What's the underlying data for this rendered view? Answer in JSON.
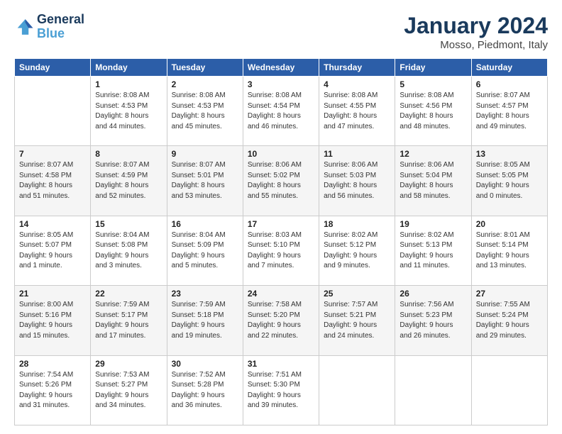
{
  "logo": {
    "line1": "General",
    "line2": "Blue"
  },
  "title": "January 2024",
  "subtitle": "Mosso, Piedmont, Italy",
  "days_of_week": [
    "Sunday",
    "Monday",
    "Tuesday",
    "Wednesday",
    "Thursday",
    "Friday",
    "Saturday"
  ],
  "weeks": [
    [
      {
        "day": "",
        "info": ""
      },
      {
        "day": "1",
        "info": "Sunrise: 8:08 AM\nSunset: 4:53 PM\nDaylight: 8 hours\nand 44 minutes."
      },
      {
        "day": "2",
        "info": "Sunrise: 8:08 AM\nSunset: 4:53 PM\nDaylight: 8 hours\nand 45 minutes."
      },
      {
        "day": "3",
        "info": "Sunrise: 8:08 AM\nSunset: 4:54 PM\nDaylight: 8 hours\nand 46 minutes."
      },
      {
        "day": "4",
        "info": "Sunrise: 8:08 AM\nSunset: 4:55 PM\nDaylight: 8 hours\nand 47 minutes."
      },
      {
        "day": "5",
        "info": "Sunrise: 8:08 AM\nSunset: 4:56 PM\nDaylight: 8 hours\nand 48 minutes."
      },
      {
        "day": "6",
        "info": "Sunrise: 8:07 AM\nSunset: 4:57 PM\nDaylight: 8 hours\nand 49 minutes."
      }
    ],
    [
      {
        "day": "7",
        "info": "Sunrise: 8:07 AM\nSunset: 4:58 PM\nDaylight: 8 hours\nand 51 minutes."
      },
      {
        "day": "8",
        "info": "Sunrise: 8:07 AM\nSunset: 4:59 PM\nDaylight: 8 hours\nand 52 minutes."
      },
      {
        "day": "9",
        "info": "Sunrise: 8:07 AM\nSunset: 5:01 PM\nDaylight: 8 hours\nand 53 minutes."
      },
      {
        "day": "10",
        "info": "Sunrise: 8:06 AM\nSunset: 5:02 PM\nDaylight: 8 hours\nand 55 minutes."
      },
      {
        "day": "11",
        "info": "Sunrise: 8:06 AM\nSunset: 5:03 PM\nDaylight: 8 hours\nand 56 minutes."
      },
      {
        "day": "12",
        "info": "Sunrise: 8:06 AM\nSunset: 5:04 PM\nDaylight: 8 hours\nand 58 minutes."
      },
      {
        "day": "13",
        "info": "Sunrise: 8:05 AM\nSunset: 5:05 PM\nDaylight: 9 hours\nand 0 minutes."
      }
    ],
    [
      {
        "day": "14",
        "info": "Sunrise: 8:05 AM\nSunset: 5:07 PM\nDaylight: 9 hours\nand 1 minute."
      },
      {
        "day": "15",
        "info": "Sunrise: 8:04 AM\nSunset: 5:08 PM\nDaylight: 9 hours\nand 3 minutes."
      },
      {
        "day": "16",
        "info": "Sunrise: 8:04 AM\nSunset: 5:09 PM\nDaylight: 9 hours\nand 5 minutes."
      },
      {
        "day": "17",
        "info": "Sunrise: 8:03 AM\nSunset: 5:10 PM\nDaylight: 9 hours\nand 7 minutes."
      },
      {
        "day": "18",
        "info": "Sunrise: 8:02 AM\nSunset: 5:12 PM\nDaylight: 9 hours\nand 9 minutes."
      },
      {
        "day": "19",
        "info": "Sunrise: 8:02 AM\nSunset: 5:13 PM\nDaylight: 9 hours\nand 11 minutes."
      },
      {
        "day": "20",
        "info": "Sunrise: 8:01 AM\nSunset: 5:14 PM\nDaylight: 9 hours\nand 13 minutes."
      }
    ],
    [
      {
        "day": "21",
        "info": "Sunrise: 8:00 AM\nSunset: 5:16 PM\nDaylight: 9 hours\nand 15 minutes."
      },
      {
        "day": "22",
        "info": "Sunrise: 7:59 AM\nSunset: 5:17 PM\nDaylight: 9 hours\nand 17 minutes."
      },
      {
        "day": "23",
        "info": "Sunrise: 7:59 AM\nSunset: 5:18 PM\nDaylight: 9 hours\nand 19 minutes."
      },
      {
        "day": "24",
        "info": "Sunrise: 7:58 AM\nSunset: 5:20 PM\nDaylight: 9 hours\nand 22 minutes."
      },
      {
        "day": "25",
        "info": "Sunrise: 7:57 AM\nSunset: 5:21 PM\nDaylight: 9 hours\nand 24 minutes."
      },
      {
        "day": "26",
        "info": "Sunrise: 7:56 AM\nSunset: 5:23 PM\nDaylight: 9 hours\nand 26 minutes."
      },
      {
        "day": "27",
        "info": "Sunrise: 7:55 AM\nSunset: 5:24 PM\nDaylight: 9 hours\nand 29 minutes."
      }
    ],
    [
      {
        "day": "28",
        "info": "Sunrise: 7:54 AM\nSunset: 5:26 PM\nDaylight: 9 hours\nand 31 minutes."
      },
      {
        "day": "29",
        "info": "Sunrise: 7:53 AM\nSunset: 5:27 PM\nDaylight: 9 hours\nand 34 minutes."
      },
      {
        "day": "30",
        "info": "Sunrise: 7:52 AM\nSunset: 5:28 PM\nDaylight: 9 hours\nand 36 minutes."
      },
      {
        "day": "31",
        "info": "Sunrise: 7:51 AM\nSunset: 5:30 PM\nDaylight: 9 hours\nand 39 minutes."
      },
      {
        "day": "",
        "info": ""
      },
      {
        "day": "",
        "info": ""
      },
      {
        "day": "",
        "info": ""
      }
    ]
  ]
}
